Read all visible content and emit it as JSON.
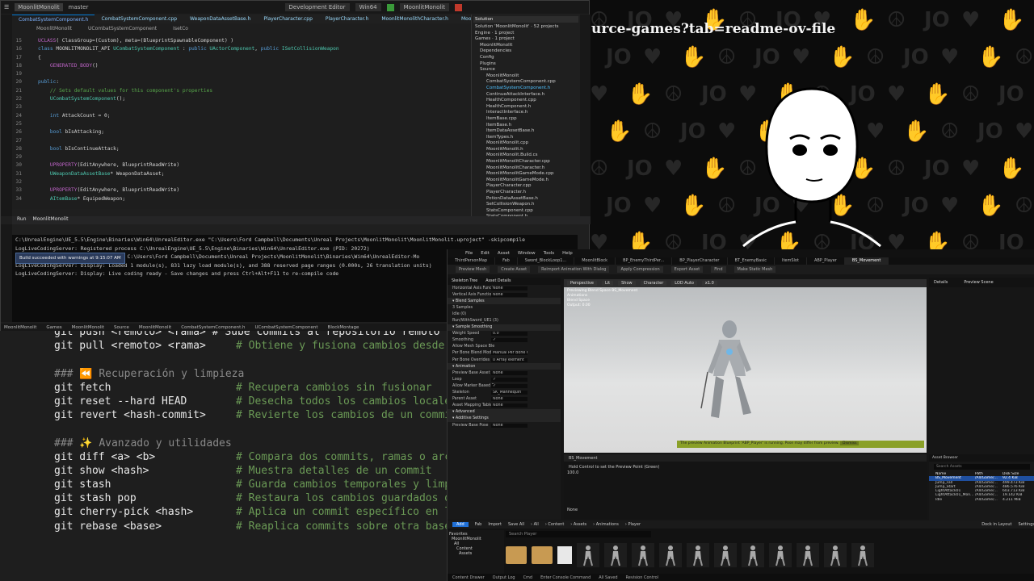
{
  "cheatsheet": {
    "partial_line": "git push <remoto> <rama>  # Sube commits al repositorio remoto",
    "lines": [
      {
        "cmd": "git pull <remoto> <rama>",
        "comment": "# Obtiene y fusiona cambios desde"
      },
      {
        "cmd": "",
        "comment": ""
      },
      {
        "heading": "### ⏪ Recuperación y limpieza"
      },
      {
        "cmd": "git fetch",
        "comment": "# Recupera cambios sin fusionar"
      },
      {
        "cmd": "git reset --hard HEAD",
        "comment": "# Desecha todos los cambios locale"
      },
      {
        "cmd": "git revert <hash-commit>",
        "comment": "# Revierte los cambios de un commi"
      },
      {
        "cmd": "",
        "comment": ""
      },
      {
        "heading": "### ✨ Avanzado y utilidades"
      },
      {
        "cmd": "git diff <a> <b>",
        "comment": "# Compara dos commits, ramas o arc"
      },
      {
        "cmd": "git show <hash>",
        "comment": "# Muestra detalles de un commit"
      },
      {
        "cmd": "git stash",
        "comment": "# Guarda cambios temporales y limp"
      },
      {
        "cmd": "git stash pop",
        "comment": "# Restaura los cambios guardados d"
      },
      {
        "cmd": "git cherry-pick <hash>",
        "comment": "# Aplica un commit específico en l"
      },
      {
        "cmd": "git rebase <base>",
        "comment": "# Reaplica commits sobre otra base"
      }
    ]
  },
  "stream": {
    "banner": "urce-games?tab=readme-ov-file",
    "pattern_symbols": [
      "☮",
      "JO",
      "♥",
      "✋"
    ]
  },
  "vs": {
    "solution_button": "MoonlitMonolit",
    "branch": "master",
    "config": "Development Editor",
    "platform": "Win64",
    "target": "MoonlitMonolit",
    "tabs": [
      "CombatSystemComponent.h",
      "CombatSystemComponent.cpp",
      "WeaponDataAssetBase.h",
      "PlayerCharacter.cpp",
      "PlayerCharacter.h",
      "MoonlitMonolithCharacter.h",
      "MoonlitMo"
    ],
    "breadcrumbs": [
      "MoonlitMonolit",
      "UCombatSystemComponent",
      "IsetCo"
    ],
    "code": [
      {
        "n": "15",
        "html": "<span class='mac'>UCLASS</span>( ClassGroup=(Custom), meta=(BlueprintSpawnableComponent) )"
      },
      {
        "n": "16",
        "html": "<span class='kw'>class</span> MOONLITMONOLIT_API <span class='ty'>UCombatSystemComponent</span> : <span class='kw'>public</span> <span class='ty'>UActorComponent</span>, <span class='kw'>public</span> <span class='ty'>ISetCollisionWeapon</span>"
      },
      {
        "n": "17",
        "html": "{"
      },
      {
        "n": "18",
        "html": "&nbsp;&nbsp;&nbsp;&nbsp;<span class='mac'>GENERATED_BODY</span>()"
      },
      {
        "n": "19",
        "html": ""
      },
      {
        "n": "20",
        "html": "<span class='kw'>public</span>:"
      },
      {
        "n": "21",
        "html": "&nbsp;&nbsp;&nbsp;&nbsp;<span class='cmt'>// Sets default values for this component's properties</span>"
      },
      {
        "n": "22",
        "html": "&nbsp;&nbsp;&nbsp;&nbsp;<span class='ty'>UCombatSystemComponent</span>();"
      },
      {
        "n": "23",
        "html": ""
      },
      {
        "n": "24",
        "html": "&nbsp;&nbsp;&nbsp;&nbsp;<span class='kw'>int</span> AttackCount = 0;"
      },
      {
        "n": "25",
        "html": ""
      },
      {
        "n": "26",
        "html": "&nbsp;&nbsp;&nbsp;&nbsp;<span class='kw'>bool</span> bIsAttacking;"
      },
      {
        "n": "27",
        "html": ""
      },
      {
        "n": "28",
        "html": "&nbsp;&nbsp;&nbsp;&nbsp;<span class='kw'>bool</span> bIsContinueAttack;"
      },
      {
        "n": "29",
        "html": ""
      },
      {
        "n": "30",
        "html": "&nbsp;&nbsp;&nbsp;&nbsp;<span class='mac'>UPROPERTY</span>(EditAnywhere, BlueprintReadWrite)"
      },
      {
        "n": "31",
        "html": "&nbsp;&nbsp;&nbsp;&nbsp;<span class='ty'>UWeaponDataAssetBase</span>* WeaponDataAsset;"
      },
      {
        "n": "32",
        "html": ""
      },
      {
        "n": "33",
        "html": "&nbsp;&nbsp;&nbsp;&nbsp;<span class='mac'>UPROPERTY</span>(EditAnywhere, BlueprintReadWrite)"
      },
      {
        "n": "34",
        "html": "&nbsp;&nbsp;&nbsp;&nbsp;<span class='ty'>AItemBase</span>* EquipedWeapon;"
      }
    ],
    "solution_title": "Solution",
    "solution_items": [
      "Solution 'MoonlitMonolit' · 52 projects",
      "Engine · 1 project",
      "Games · 1 project",
      "MoonlitMonolit",
      "Dependencies",
      "Config",
      "Plugins",
      "Source",
      "MoonlitMonolit",
      "CombatSystemComponent.cpp",
      "CombatSystemComponent.h",
      "ContinueAttackInterface.h",
      "HealthComponent.cpp",
      "HealthComponent.h",
      "InteractInterface.h",
      "ItemBase.cpp",
      "ItemBase.h",
      "ItemDataAssetBase.h",
      "ItemTypes.h",
      "MoonlitMonolit.cpp",
      "MoonlitMonolit.h",
      "MoonlitMonolit.Build.cs",
      "MoonlitMonolitCharacter.cpp",
      "MoonlitMonolitCharacter.h",
      "MoonlitMonolitGameMode.cpp",
      "MoonlitMonolitGameMode.h",
      "PlayerCharacter.cpp",
      "PlayerCharacter.h",
      "PotionDataAssetBase.h",
      "SetCollisionWeapon.h",
      "StatsComponent.cpp",
      "StatsComponent.h"
    ],
    "run_tab": "Run",
    "run_target": "MoonlitMonolit",
    "console": [
      "C:\\UnrealEngine\\UE_5.5\\Engine\\Binaries\\Win64\\UnrealEditor.exe \"C:\\Users\\Ford Campbell\\Documents\\Unreal Projects\\MoonlitMonolit\\MoonlitMonolit.uproject\" -skipcompile",
      "LogLiveCodingServer: Registered process C:\\UnrealEngine\\UE_5.5\\Engine\\Binaries\\Win64\\UnrealEditor.exe (PID: 20272)",
      "LogLiveCodingServer: Loading module C:\\Users\\Ford Campbell\\Documents\\Unreal Projects\\MoonlitMonolit\\Binaries\\Win64\\UnrealEditor-Mo",
      "LogLiveCodingServer: Display: Loaded 1 module(s), 831 lazy load module(s), and 388 reserved page ranges (0.000s, 26 translation units)",
      "LogLiveCodingServer: Display: Live coding ready - Save changes and press Ctrl+Alt+F11 to re-compile code"
    ],
    "build_toast": "Build succeeded with warnings at 9:15:07 AM",
    "status_breadcrumbs": [
      "MoonlitMonolit",
      "Games",
      "MoonlitMonolit",
      "Source",
      "MoonlitMonolit",
      "CombatSystemComponent.h",
      "UCombatSystemComponent",
      "BlockMontage"
    ]
  },
  "ue": {
    "menu": [
      "File",
      "Edit",
      "Asset",
      "Window",
      "Tools",
      "Help"
    ],
    "tabs": [
      "ThirdPersonMap",
      "Fab",
      "Sword_BlockLoop1...",
      "MoonlitBlock",
      "BP_EnemyThirdPer...",
      "BP_PlayerCharacter",
      "BT_EnemyBasic",
      "ItemSlot",
      "ABP_Player",
      "BS_Movement"
    ],
    "toolbar": [
      "Preview Mesh",
      "Create Asset",
      "Reimport Animation With Dialog",
      "Apply Compression",
      "Export Asset",
      "Find",
      "Make Static Mesh"
    ],
    "panel_tabs": [
      "Skeleton Tree",
      "Asset Details"
    ],
    "details_rows": [
      {
        "label": "Horizontal Axis Function",
        "value": "None"
      },
      {
        "label": "Vertical Axis Function",
        "value": "None"
      },
      {
        "section": "Blend Samples"
      },
      {
        "label": "3 Samples",
        "value": ""
      },
      {
        "label": "Idle (0)",
        "value": ""
      },
      {
        "label": "Run/WithSword_UE1 (3)",
        "value": ""
      },
      {
        "section": "Sample Smoothing"
      },
      {
        "label": "Weight Speed",
        "value": "0.0"
      },
      {
        "label": "Smoothing",
        "value": "✓"
      },
      {
        "label": "Allow Mesh Space Ble",
        "value": ""
      },
      {
        "label": "Per Bone Blend Mode",
        "value": "Manual Per Bone Override"
      },
      {
        "label": "Per Bone Overrides",
        "value": "0 Array element"
      },
      {
        "section": "Animation"
      },
      {
        "label": "Preview Base Asset",
        "value": "None"
      },
      {
        "label": "Loop",
        "value": "✓"
      },
      {
        "label": "Allow Marker Based S",
        "value": "✓"
      },
      {
        "label": "Skeleton",
        "value": "SK_Mannequin"
      },
      {
        "label": "Parent Asset",
        "value": "None"
      },
      {
        "label": "Asset Mapping Table",
        "value": "None"
      },
      {
        "section": "Advanced"
      },
      {
        "section": "Additive Settings"
      },
      {
        "label": "Preview Base Pose",
        "value": "None"
      }
    ],
    "viewport": {
      "buttons": [
        "Perspective",
        "Lit",
        "Show",
        "Character",
        "LOD Auto",
        "x1.0"
      ],
      "info": [
        "Previewing Blend Space BS_Movement",
        "Animations",
        "Blend Space",
        "Output: 0.00"
      ],
      "warning": "The preview Animation Blueprint 'ABP_Player' is running. Pose may differ from preview.",
      "warning_btn": "Dismiss"
    },
    "timeline": {
      "tab": "BS_Movement",
      "hint": "Hold Control to set the Preview Point (Green)",
      "axis_top": "100.0",
      "axis_bottom": "None"
    },
    "right_tabs": [
      "Details",
      "Preview Scene"
    ],
    "asset_browser": {
      "title": "Asset Browser",
      "search": "Search Assets",
      "columns": [
        "Name",
        "Path",
        "Disk Size"
      ],
      "rows": [
        {
          "name": "BS_Movement",
          "path": "/All/Game/...",
          "size": "92.4 KiB"
        },
        {
          "name": "Jump_Fall",
          "path": "/All/Game/...",
          "size": "499.473 KiB"
        },
        {
          "name": "Jump_Start",
          "path": "/All/Game/...",
          "size": "486.576 KiB"
        },
        {
          "name": "LightAttack01",
          "path": "/All/Game/...",
          "size": "603.713 KiB"
        },
        {
          "name": "LightAttack01_Mon...",
          "path": "/All/Game/...",
          "size": "19.142 KiB"
        },
        {
          "name": "Idle",
          "path": "/All/Game/...",
          "size": "4.211 MiB"
        }
      ]
    },
    "content": {
      "buttons": [
        "Add",
        "Fab",
        "Import",
        "Save All"
      ],
      "path": [
        "All",
        "Content",
        "Assets",
        "Animations",
        "Player"
      ],
      "search": "Search Player",
      "settings": "Settings",
      "dock": "Dock in Layout",
      "tree": [
        "Favorites",
        "MoonlitMonolit",
        "All",
        "Content",
        "Assets"
      ]
    },
    "status": [
      "Content Drawer",
      "Output Log",
      "Cmd",
      "Enter Console Command",
      "All Saved",
      "Revision Control"
    ]
  }
}
